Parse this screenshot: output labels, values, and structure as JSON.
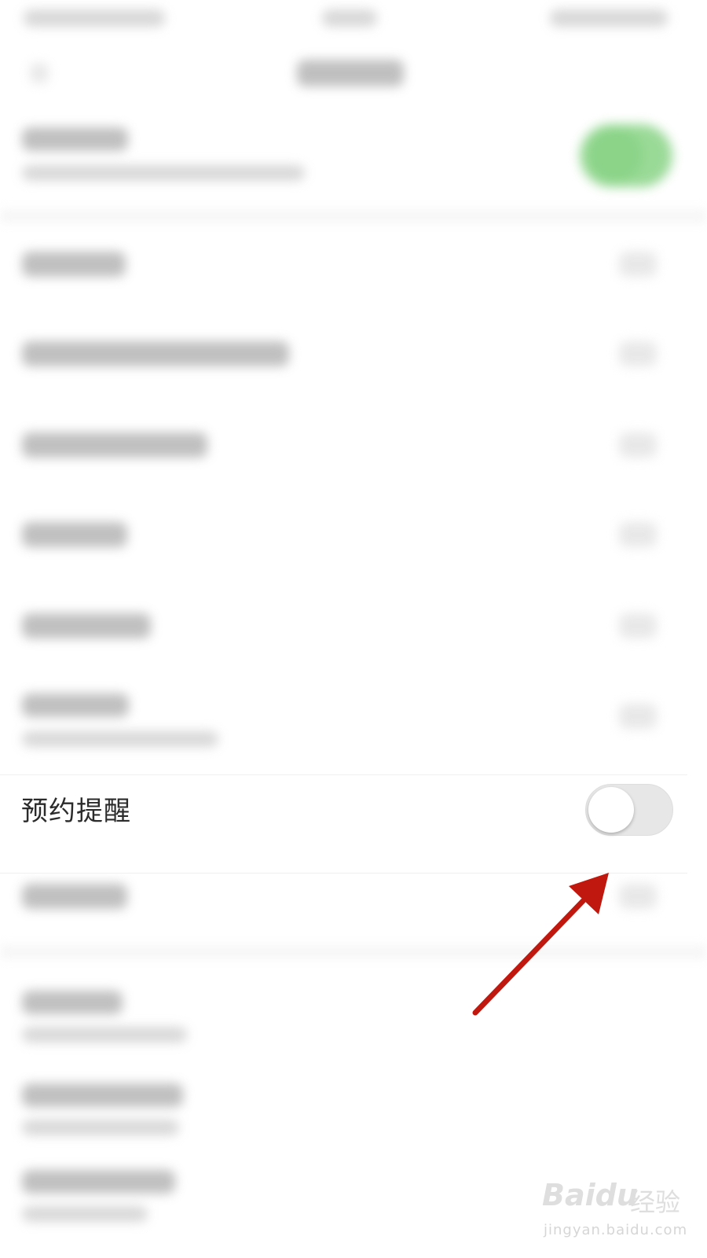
{
  "setting_row": {
    "label": "预约提醒",
    "toggle_on": false
  },
  "watermark": {
    "logo": "Baidu",
    "text": "经验",
    "url": "jingyan.baidu.com"
  },
  "colors": {
    "annotation_arrow": "#c0180f",
    "toggle_on_green": "#8fd68c",
    "toggle_off_track": "#e7e7e7"
  }
}
